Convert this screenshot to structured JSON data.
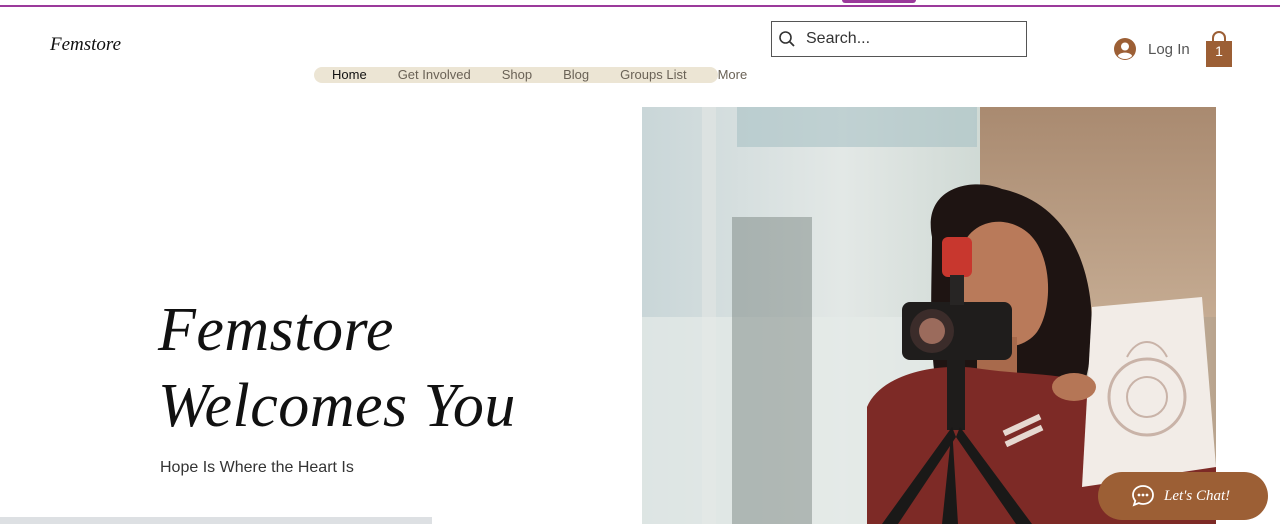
{
  "site": {
    "logo": "Femstore"
  },
  "header": {
    "search_placeholder": "Search...",
    "login_label": "Log In",
    "cart_count": "1"
  },
  "nav": {
    "items": [
      {
        "label": "Home",
        "active": true
      },
      {
        "label": "Get Involved"
      },
      {
        "label": "Shop"
      },
      {
        "label": "Blog"
      },
      {
        "label": "Groups List"
      },
      {
        "label": "More"
      }
    ]
  },
  "hero": {
    "title_line1": "Femstore",
    "title_line2": "Welcomes You",
    "subtitle": "Hope Is Where the Heart Is"
  },
  "chat": {
    "label": "Let's Chat!"
  },
  "colors": {
    "accent_purple": "#9b3a9b",
    "brand_brown": "#9c5f35",
    "nav_bg": "#ece5d4"
  }
}
